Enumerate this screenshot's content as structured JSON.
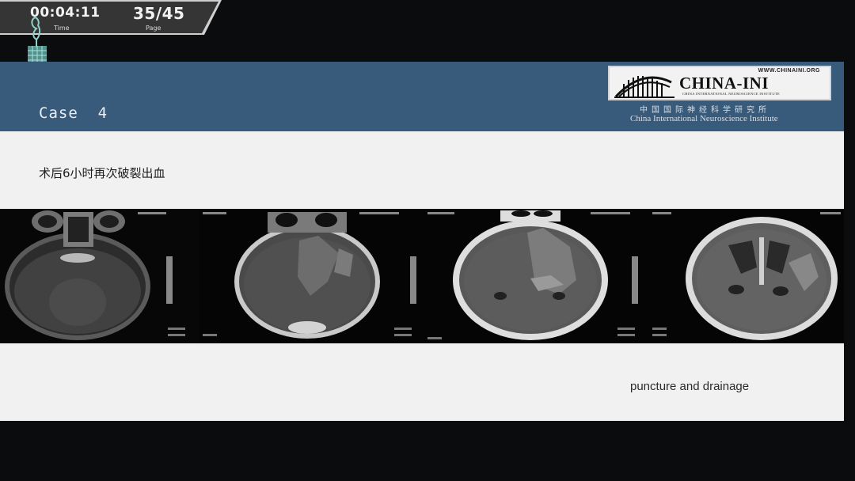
{
  "player": {
    "time_value": "00:04:11",
    "time_label": "Time",
    "page_value": "35/45",
    "page_label": "Page",
    "logo_icon": "tree-logo-icon"
  },
  "slide": {
    "title": "Case  4",
    "subtitle": "术后6小时再次破裂出血",
    "caption": "puncture and drainage",
    "header_color": "#385b7c",
    "body_color": "#f1f1f2"
  },
  "institute_logo": {
    "url": "WWW.CHINAINI.ORG",
    "name": "CHINA-INI",
    "subname": "CHINA INTERNATIONAL NEUROSCIENCE INSTITUTE",
    "name_cn": "中国国际神经科学研究所",
    "name_en": "China International Neuroscience Institute"
  },
  "ct_images": {
    "count": 4,
    "icon": "ct-scan-image"
  }
}
